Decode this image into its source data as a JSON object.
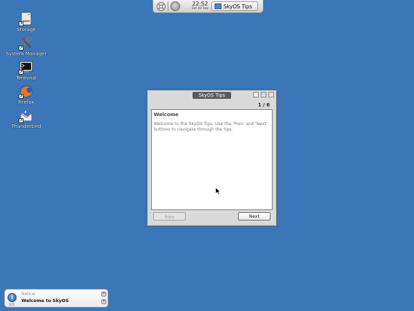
{
  "taskbar": {
    "time": "22:52",
    "date": "Sat 03 Sep",
    "app_button_label": "SkyOS Tips"
  },
  "desktop_icons": [
    {
      "label": "Storage",
      "icon": "storage-icon"
    },
    {
      "label": "System Manager",
      "icon": "tools-icon"
    },
    {
      "label": "Terminal",
      "icon": "terminal-icon"
    },
    {
      "label": "Firefox",
      "icon": "firefox-icon"
    },
    {
      "label": "Thunderbird",
      "icon": "thunderbird-icon"
    }
  ],
  "tips_window": {
    "title": "SkyOS Tips",
    "page_indicator": "1 / 6",
    "tip_title": "Welcome",
    "tip_text": "Welcome to the SkyOS Tips. Use the 'Prev' and 'Next' buttons to navigate through the tips.",
    "prev_label": "Prev",
    "next_label": "Next"
  },
  "notice": {
    "label": "Notice:",
    "message": "Welcome to SkyOS",
    "count": "1/2"
  },
  "colors": {
    "desktop_background": "#3a76b8",
    "window_background": "#d9d9d9",
    "title_pill": "#5a5a5a"
  }
}
